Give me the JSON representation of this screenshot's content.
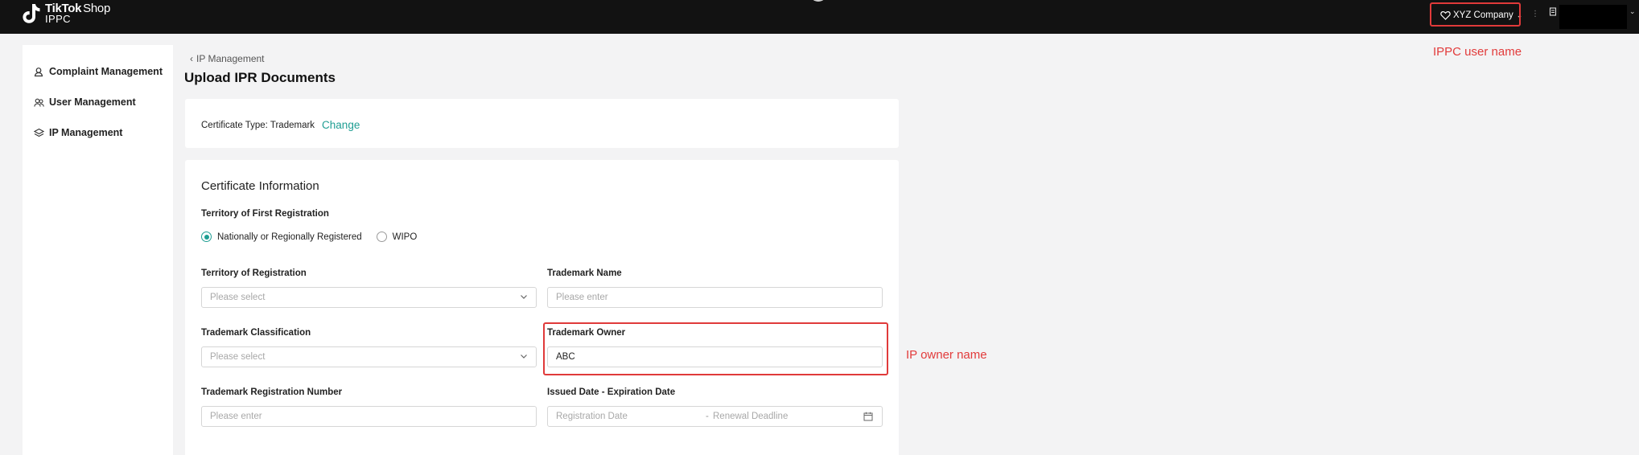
{
  "app": {
    "logo_main": "TikTok",
    "logo_shop": "Shop",
    "logo_sub": "IPPC"
  },
  "header": {
    "company": "XYZ Company"
  },
  "annotations": {
    "user_name_note": "IPPC user name",
    "owner_name_note": "IP owner name",
    "color": "#e23b3b"
  },
  "sidebar": {
    "items": [
      {
        "label": "Complaint Management",
        "icon": "complaint-icon"
      },
      {
        "label": "User Management",
        "icon": "users-icon"
      },
      {
        "label": "IP Management",
        "icon": "layers-icon"
      }
    ]
  },
  "breadcrumb": {
    "back_label": "IP Management"
  },
  "page": {
    "title": "Upload IPR Documents"
  },
  "certificate_type": {
    "label": "Certificate Type: Trademark",
    "change_label": "Change",
    "accent": "#1f9e93"
  },
  "cert_info": {
    "title": "Certificate Information",
    "territory_first": {
      "label": "Territory of First Registration",
      "options": [
        "Nationally or Regionally Registered",
        "WIPO"
      ],
      "selected": "Nationally or Regionally Registered"
    },
    "territory_reg": {
      "label": "Territory of Registration",
      "placeholder": "Please select"
    },
    "tm_name": {
      "label": "Trademark Name",
      "placeholder": "Please enter"
    },
    "tm_class": {
      "label": "Trademark Classification",
      "placeholder": "Please select"
    },
    "tm_owner": {
      "label": "Trademark Owner",
      "value": "ABC"
    },
    "tm_reg_num": {
      "label": "Trademark Registration Number",
      "placeholder": "Please enter"
    },
    "dates": {
      "label": "Issued Date - Expiration Date",
      "start_placeholder": "Registration Date",
      "separator": "-",
      "end_placeholder": "Renewal Deadline"
    }
  }
}
